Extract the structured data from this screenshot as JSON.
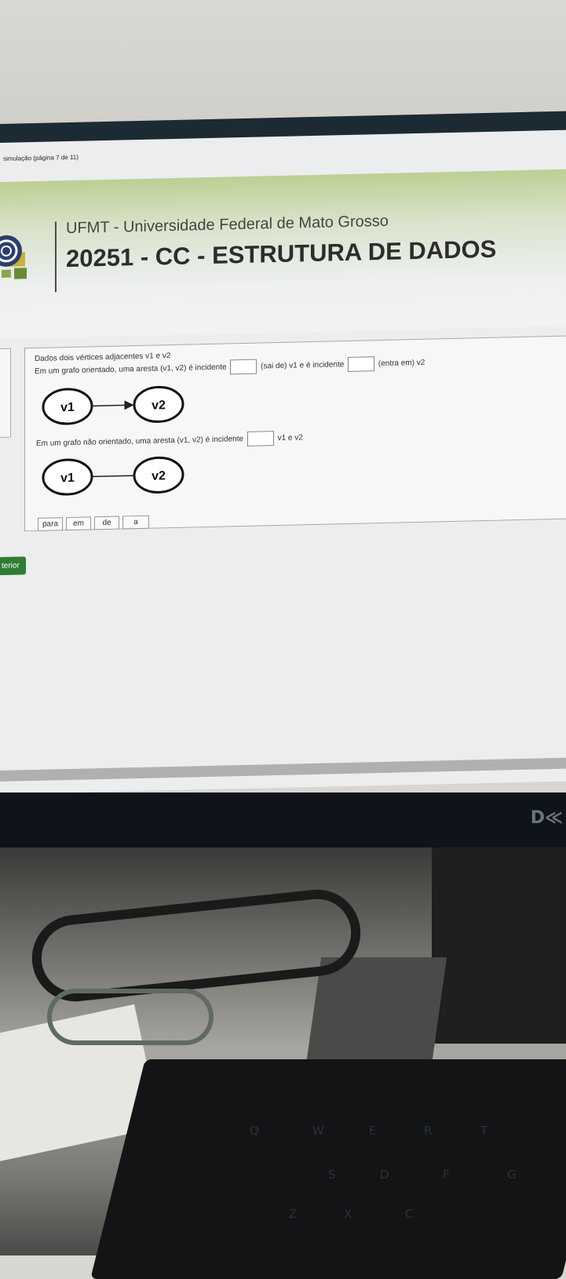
{
  "window": {
    "tab_title": "simulação (página 7 de 11)"
  },
  "header": {
    "university": "UFMT - Universidade Federal de Mato Grosso",
    "course": "20251 - CC - ESTRUTURA DE DADOS"
  },
  "question": {
    "intro": "Dados dois vértices adjacentes v1 e v2",
    "oriented_part1": "Em um grafo orientado, uma aresta (v1, v2) é incidente",
    "oriented_part2": "(sai de) v1 e é incidente",
    "oriented_part3": "(entra em) v2",
    "unoriented_part1": "Em um grafo não orientado, uma aresta (v1, v2) é incidente",
    "unoriented_part2": "v1 e v2",
    "graph1": {
      "node_a": "v1",
      "node_b": "v2"
    },
    "graph2": {
      "node_a": "v1",
      "node_b": "v2"
    },
    "options": [
      "para",
      "em",
      "de",
      "a"
    ]
  },
  "navigation": {
    "previous_label": "terior"
  },
  "monitor": {
    "brand": "D≪"
  },
  "keyboard": {
    "keys": [
      "Q",
      "W",
      "E",
      "R",
      "T",
      "S",
      "D",
      "F",
      "G",
      "Z",
      "X",
      "C"
    ]
  }
}
